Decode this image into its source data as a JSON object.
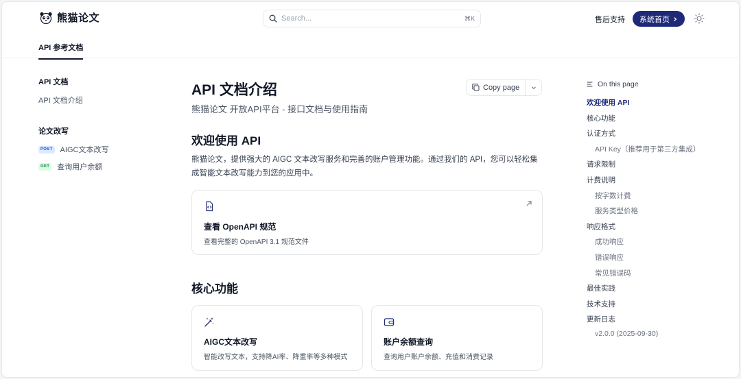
{
  "header": {
    "brand": "熊猫论文",
    "search_placeholder": "Search...",
    "search_shortcut": "⌘K",
    "support_label": "售后支持",
    "home_button": "系统首页"
  },
  "tabs": [
    {
      "label": "API 参考文档",
      "active": true
    }
  ],
  "sidebar": {
    "sections": [
      {
        "title": "API 文档",
        "items": [
          {
            "label": "API 文档介绍",
            "method": ""
          }
        ]
      },
      {
        "title": "论文改写",
        "items": [
          {
            "label": "AIGC文本改写",
            "method": "POST"
          },
          {
            "label": "查询用户余额",
            "method": "GET"
          }
        ]
      }
    ]
  },
  "main": {
    "title": "API 文档介绍",
    "subtitle": "熊猫论文 开放API平台 - 接口文档与使用指南",
    "copy_button": "Copy page",
    "welcome_heading": "欢迎使用 API",
    "welcome_text": "熊猫论文，提供强大的 AIGC 文本改写服务和完善的账户管理功能。通过我们的 API，您可以轻松集成智能文本改写能力到您的应用中。",
    "openapi_card": {
      "title": "查看 OpenAPI 规范",
      "desc": "查看完整的 OpenAPI 3.1 规范文件",
      "icon": "code-file-icon"
    },
    "features_heading": "核心功能",
    "features": [
      {
        "title": "AIGC文本改写",
        "desc": "智能改写文本，支持降AI率、降重率等多种模式",
        "icon": "magic-wand-icon"
      },
      {
        "title": "账户余额查询",
        "desc": "查询用户账户余额、充值和消费记录",
        "icon": "wallet-icon"
      }
    ]
  },
  "toc": {
    "heading": "On this page",
    "items": [
      {
        "label": "欢迎使用 API",
        "level": 1,
        "active": true
      },
      {
        "label": "核心功能",
        "level": 1
      },
      {
        "label": "认证方式",
        "level": 1
      },
      {
        "label": "API Key（推荐用于第三方集成）",
        "level": 2
      },
      {
        "label": "请求限制",
        "level": 1
      },
      {
        "label": "计费说明",
        "level": 1
      },
      {
        "label": "按字数计费",
        "level": 2
      },
      {
        "label": "服务类型价格",
        "level": 2
      },
      {
        "label": "响应格式",
        "level": 1
      },
      {
        "label": "成功响应",
        "level": 2
      },
      {
        "label": "错误响应",
        "level": 2
      },
      {
        "label": "常见错误码",
        "level": 2
      },
      {
        "label": "最佳实践",
        "level": 1
      },
      {
        "label": "技术支持",
        "level": 1
      },
      {
        "label": "更新日志",
        "level": 1
      },
      {
        "label": "v2.0.0 (2025-09-30)",
        "level": 2
      }
    ]
  },
  "colors": {
    "accent": "#1e2a78",
    "post": "#1d4ed8",
    "get": "#15803d"
  }
}
